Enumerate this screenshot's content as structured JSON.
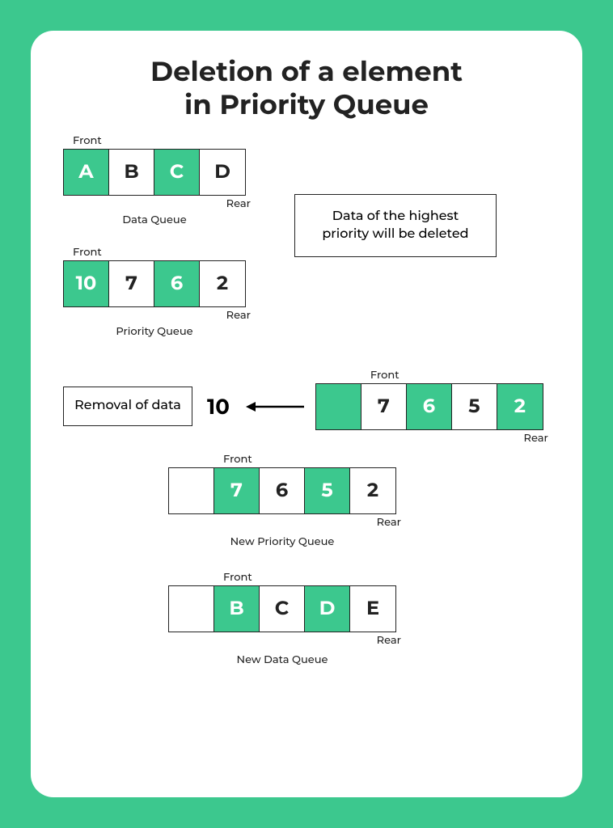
{
  "title_l1": "Deletion of a element",
  "title_l2": "in Priority Queue",
  "labels": {
    "front": "Front",
    "rear": "Rear"
  },
  "dataQueue": {
    "caption": "Data Queue",
    "cells": [
      "A",
      "B",
      "C",
      "D"
    ]
  },
  "priorityQueue": {
    "caption": "Priority Queue",
    "cells": [
      "10",
      "7",
      "6",
      "2"
    ]
  },
  "infoBox": "Data of the highest priority will be deleted",
  "removal": {
    "label": "Removal of data",
    "value": "10"
  },
  "afterRemovalQueue": {
    "cells": [
      "",
      "7",
      "6",
      "5",
      "2"
    ]
  },
  "newPriorityQueue": {
    "caption": "New Priority Queue",
    "cells": [
      "",
      "7",
      "6",
      "5",
      "2"
    ]
  },
  "newDataQueue": {
    "caption": "New Data Queue",
    "cells": [
      "",
      "B",
      "C",
      "D",
      "E"
    ]
  }
}
